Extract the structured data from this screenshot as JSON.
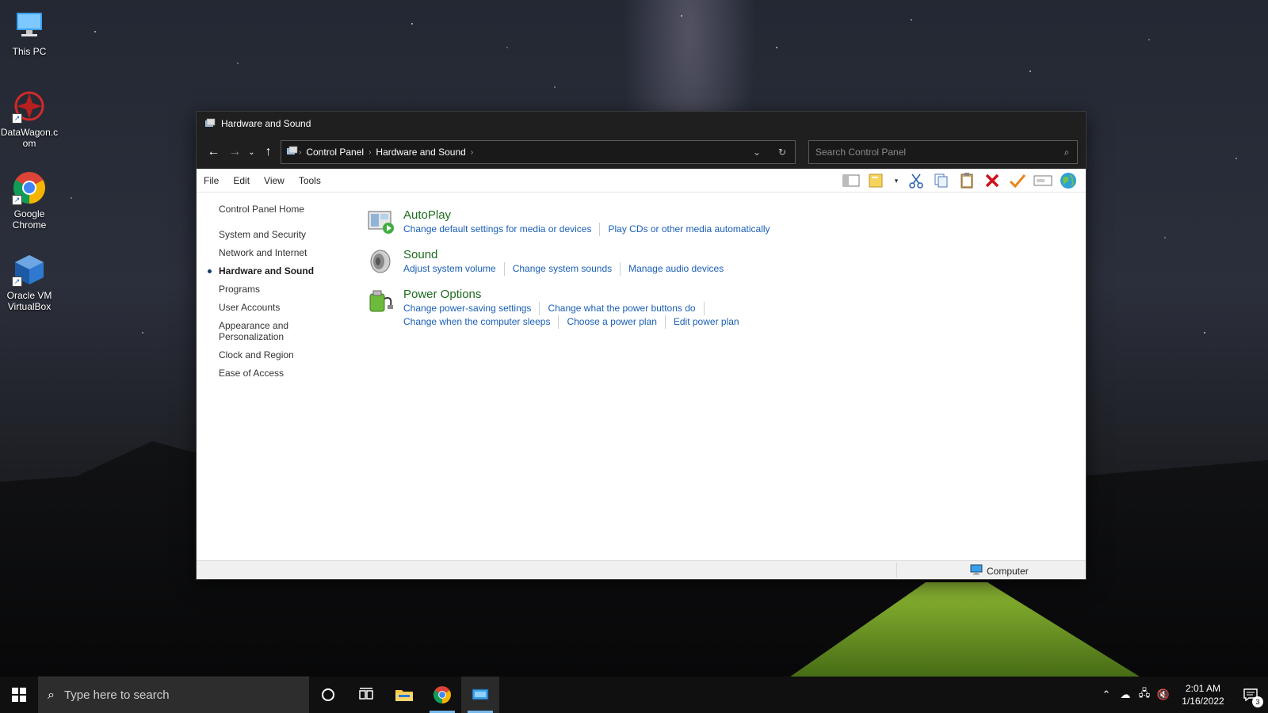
{
  "desktop": {
    "icons": [
      {
        "label": "This PC"
      },
      {
        "label": "DataWagon.com"
      },
      {
        "label": "Google Chrome"
      },
      {
        "label": "Oracle VM VirtualBox"
      }
    ]
  },
  "window": {
    "title": "Hardware and Sound",
    "breadcrumb": [
      "Control Panel",
      "Hardware and Sound"
    ],
    "search": {
      "placeholder": "Search Control Panel",
      "value": ""
    },
    "menu": [
      "File",
      "Edit",
      "View",
      "Tools"
    ],
    "toolbar_icons": [
      "panes-icon",
      "properties-icon",
      "dropdown-icon",
      "cut-icon",
      "copy-icon",
      "paste-icon",
      "delete-icon",
      "checkmark-icon",
      "rename-icon",
      "globe-icon"
    ]
  },
  "left_nav": {
    "home": "Control Panel Home",
    "items": [
      {
        "label": "System and Security",
        "active": false
      },
      {
        "label": "Network and Internet",
        "active": false
      },
      {
        "label": "Hardware and Sound",
        "active": true
      },
      {
        "label": "Programs",
        "active": false
      },
      {
        "label": "User Accounts",
        "active": false
      },
      {
        "label": "Appearance and Personalization",
        "active": false
      },
      {
        "label": "Clock and Region",
        "active": false
      },
      {
        "label": "Ease of Access",
        "active": false
      }
    ]
  },
  "categories": [
    {
      "title": "AutoPlay",
      "icon": "autoplay-icon",
      "links": [
        "Change default settings for media or devices",
        "Play CDs or other media automatically"
      ]
    },
    {
      "title": "Sound",
      "icon": "speaker-icon",
      "links": [
        "Adjust system volume",
        "Change system sounds",
        "Manage audio devices"
      ]
    },
    {
      "title": "Power Options",
      "icon": "power-options-icon",
      "links": [
        "Change power-saving settings",
        "Change what the power buttons do",
        "Change when the computer sleeps",
        "Choose a power plan",
        "Edit power plan"
      ]
    }
  ],
  "statusbar": {
    "location": "Computer"
  },
  "taskbar": {
    "search_placeholder": "Type here to search",
    "time": "2:01 AM",
    "date": "1/16/2022",
    "notifications": "3"
  },
  "colors": {
    "link": "#1a5fb4",
    "category_title": "#1e6a1e",
    "titlebar": "#1f1f1f",
    "taskbar": "#101010"
  }
}
